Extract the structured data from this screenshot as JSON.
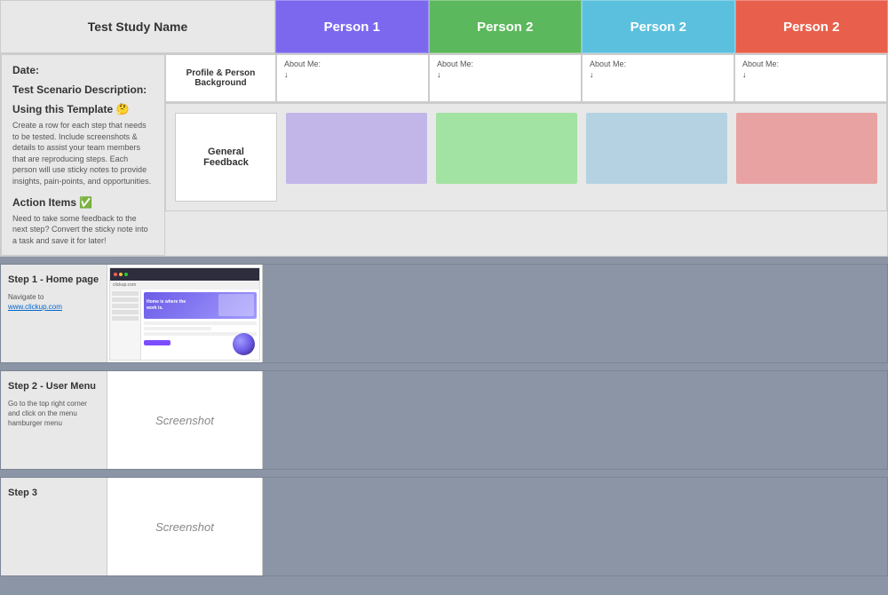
{
  "header": {
    "title": "Test Study Name",
    "persons": [
      {
        "label": "Person 1",
        "bgClass": "person1-bg"
      },
      {
        "label": "Person 2",
        "bgClass": "person2-green"
      },
      {
        "label": "Person 2",
        "bgClass": "person2-blue"
      },
      {
        "label": "Person 2",
        "bgClass": "person2-red"
      }
    ]
  },
  "sidebar": {
    "date_label": "Date:",
    "scenario_label": "Test Scenario Description:",
    "template_label": "Using this Template 🤔",
    "template_desc": "Create a row for each step that needs to be tested. Include screenshots & details to assist your team members that are reproducing steps. Each person will use sticky notes to provide insights, pain-points, and opportunities.",
    "action_label": "Action Items ✅",
    "action_desc": "Need to take some feedback to the next step? Convert the sticky note into a task and save it for later!"
  },
  "profile_section": {
    "label_line1": "Profile & Person",
    "label_line2": "Background",
    "persons": [
      {
        "about_label": "About Me:",
        "about_value": "↓"
      },
      {
        "about_label": "About Me:",
        "about_value": "↓"
      },
      {
        "about_label": "About Me:",
        "about_value": "↓"
      },
      {
        "about_label": "About Me:",
        "about_value": "↓"
      }
    ]
  },
  "feedback_section": {
    "label": "General Feedback",
    "stickies": [
      {
        "color": "purple",
        "class": "sticky-purple"
      },
      {
        "color": "green",
        "class": "sticky-green"
      },
      {
        "color": "blue",
        "class": "sticky-blue-light"
      },
      {
        "color": "pink",
        "class": "sticky-pink"
      }
    ]
  },
  "steps": [
    {
      "title": "Step 1 - Home page",
      "navigate_text": "Navigate to ",
      "navigate_link": "www.clickup.com",
      "has_screenshot": true,
      "screenshot_type": "clickup"
    },
    {
      "title": "Step 2 - User Menu",
      "navigate_text": "Go to the top right corner and click on the menu hamburger menu",
      "navigate_link": "",
      "has_screenshot": true,
      "screenshot_type": "placeholder",
      "screenshot_label": "Screenshot"
    },
    {
      "title": "Step 3",
      "navigate_text": "",
      "navigate_link": "",
      "has_screenshot": true,
      "screenshot_type": "placeholder",
      "screenshot_label": "Screenshot"
    }
  ]
}
